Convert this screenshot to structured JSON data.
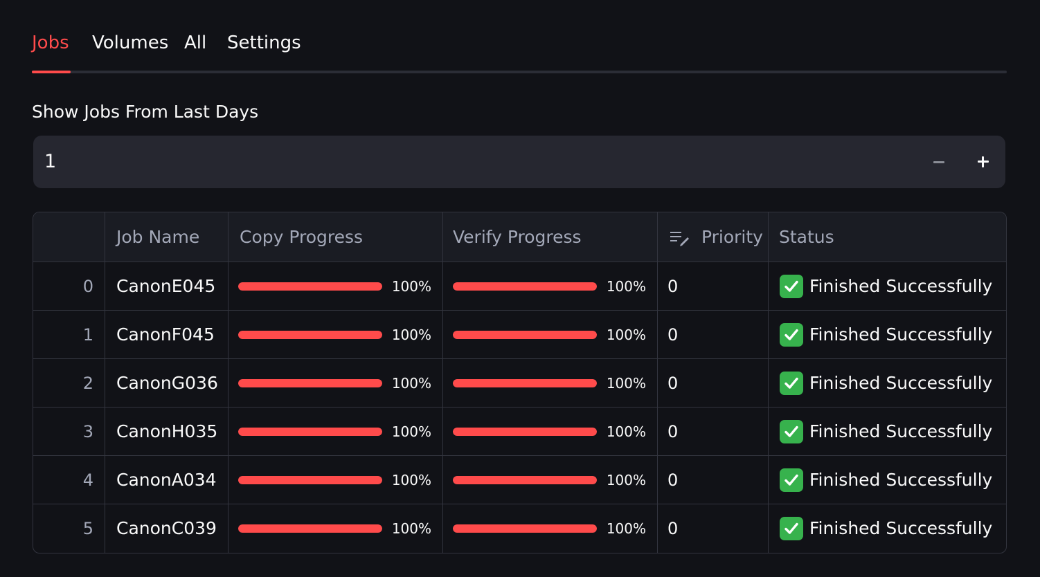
{
  "tabs": [
    {
      "label": "Jobs",
      "active": true
    },
    {
      "label": "Volumes",
      "active": false
    },
    {
      "label": "All",
      "active": false
    },
    {
      "label": "Settings",
      "active": false
    }
  ],
  "filter": {
    "label": "Show Jobs From Last Days",
    "value": "1",
    "decrement_icon": "minus-icon",
    "increment_icon": "plus-icon"
  },
  "table": {
    "columns": {
      "index": "",
      "job_name": "Job Name",
      "copy_progress": "Copy Progress",
      "verify_progress": "Verify Progress",
      "priority": "Priority",
      "priority_icon": "edit-list-icon",
      "status": "Status"
    },
    "rows": [
      {
        "index": "0",
        "job_name": "CanonE045",
        "copy_progress": 1.0,
        "copy_label": "100%",
        "verify_progress": 1.0,
        "verify_label": "100%",
        "priority": "0",
        "status": "Finished Successfully",
        "status_icon": "check-mark-icon"
      },
      {
        "index": "1",
        "job_name": "CanonF045",
        "copy_progress": 1.0,
        "copy_label": "100%",
        "verify_progress": 1.0,
        "verify_label": "100%",
        "priority": "0",
        "status": "Finished Successfully",
        "status_icon": "check-mark-icon"
      },
      {
        "index": "2",
        "job_name": "CanonG036",
        "copy_progress": 1.0,
        "copy_label": "100%",
        "verify_progress": 1.0,
        "verify_label": "100%",
        "priority": "0",
        "status": "Finished Successfully",
        "status_icon": "check-mark-icon"
      },
      {
        "index": "3",
        "job_name": "CanonH035",
        "copy_progress": 1.0,
        "copy_label": "100%",
        "verify_progress": 1.0,
        "verify_label": "100%",
        "priority": "0",
        "status": "Finished Successfully",
        "status_icon": "check-mark-icon"
      },
      {
        "index": "4",
        "job_name": "CanonA034",
        "copy_progress": 1.0,
        "copy_label": "100%",
        "verify_progress": 1.0,
        "verify_label": "100%",
        "priority": "0",
        "status": "Finished Successfully",
        "status_icon": "check-mark-icon"
      },
      {
        "index": "5",
        "job_name": "CanonC039",
        "copy_progress": 1.0,
        "copy_label": "100%",
        "verify_progress": 1.0,
        "verify_label": "100%",
        "priority": "0",
        "status": "Finished Successfully",
        "status_icon": "check-mark-icon"
      }
    ]
  },
  "colors": {
    "accent": "#ff4b4b",
    "background": "#111217",
    "input_background": "#262730",
    "status_success": "#37b24d"
  }
}
